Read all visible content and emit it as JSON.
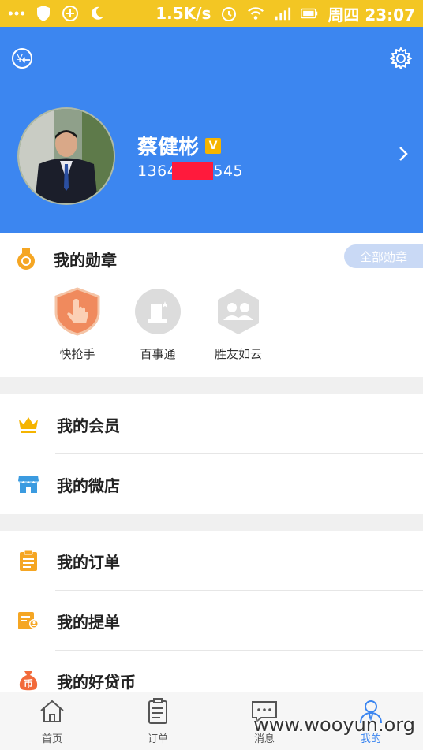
{
  "status_bar": {
    "speed": "1.5K/s",
    "day_time": "周四 23:07"
  },
  "profile": {
    "name": "蔡健彬",
    "verified_badge": "V",
    "phone_prefix": "1364",
    "phone_suffix": "545"
  },
  "medals": {
    "title": "我的勋章",
    "all_button": "全部勋章",
    "items": [
      {
        "label": "快抢手"
      },
      {
        "label": "百事通"
      },
      {
        "label": "胜友如云"
      }
    ]
  },
  "menu_section_1": [
    {
      "label": "我的会员"
    },
    {
      "label": "我的微店"
    }
  ],
  "menu_section_2": [
    {
      "label": "我的订单"
    },
    {
      "label": "我的提单"
    },
    {
      "label": "我的好贷币"
    }
  ],
  "bottom_nav": [
    {
      "label": "首页"
    },
    {
      "label": "订单"
    },
    {
      "label": "消息"
    },
    {
      "label": "我的"
    }
  ],
  "watermark": "www.wooyun.org",
  "colors": {
    "status_bar": "#f3c623",
    "header": "#3c86f0",
    "accent_orange": "#f5a623",
    "active_nav": "#3c86f0"
  }
}
